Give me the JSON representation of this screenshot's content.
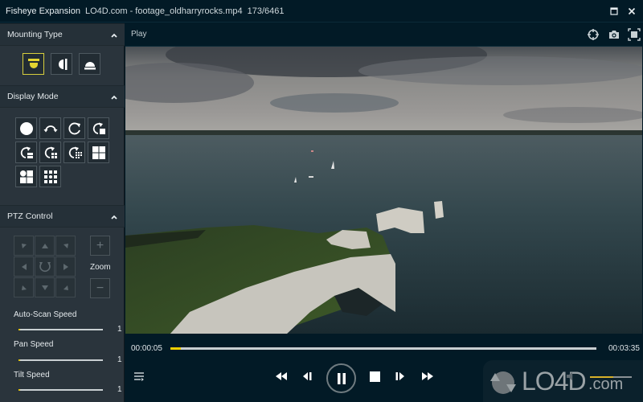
{
  "titlebar": {
    "app_name": "Fisheye Expansion",
    "file_name": "LO4D.com - footage_oldharryrocks.mp4",
    "frame_counter": "173/6461",
    "icons": [
      "maximize-icon",
      "close-icon"
    ]
  },
  "sidebar": {
    "mounting_type": {
      "title": "Mounting Type",
      "options": [
        {
          "name": "ceiling-mount",
          "active": true
        },
        {
          "name": "wall-mount",
          "active": false
        },
        {
          "name": "desktop-mount",
          "active": false
        }
      ]
    },
    "display_mode": {
      "title": "Display Mode",
      "options": [
        "original-fisheye",
        "panorama-180",
        "panorama-360",
        "panorama-360-plus-1",
        "panorama-360-plus-2",
        "panorama-360-plus-4",
        "panorama-360-plus-6",
        "quad-view",
        "fisheye-plus-3",
        "nine-view"
      ]
    },
    "ptz_control": {
      "title": "PTZ Control",
      "zoom_label": "Zoom",
      "zoom_in": "+",
      "zoom_out": "−",
      "speeds": [
        {
          "label": "Auto-Scan Speed",
          "value": "1",
          "fraction": 0.02
        },
        {
          "label": "Pan Speed",
          "value": "1",
          "fraction": 0.02
        },
        {
          "label": "Tilt Speed",
          "value": "1",
          "fraction": 0.02
        }
      ]
    }
  },
  "player": {
    "header_label": "Play",
    "header_icons": [
      "target-icon",
      "camera-icon",
      "fullscreen-icon"
    ],
    "current_time": "00:00:05",
    "total_time": "00:03:35",
    "progress_fraction": 0.024,
    "volume_fraction": 0.55,
    "buttons": [
      "playlist",
      "rewind",
      "step-back",
      "pause",
      "stop",
      "step-forward",
      "fast-forward"
    ]
  },
  "watermark": {
    "text": "LO4D",
    "suffix": ".com"
  },
  "colors": {
    "accent_yellow": "#f0d000",
    "panel_bg": "#2a343c",
    "header_bg": "#021a26"
  }
}
